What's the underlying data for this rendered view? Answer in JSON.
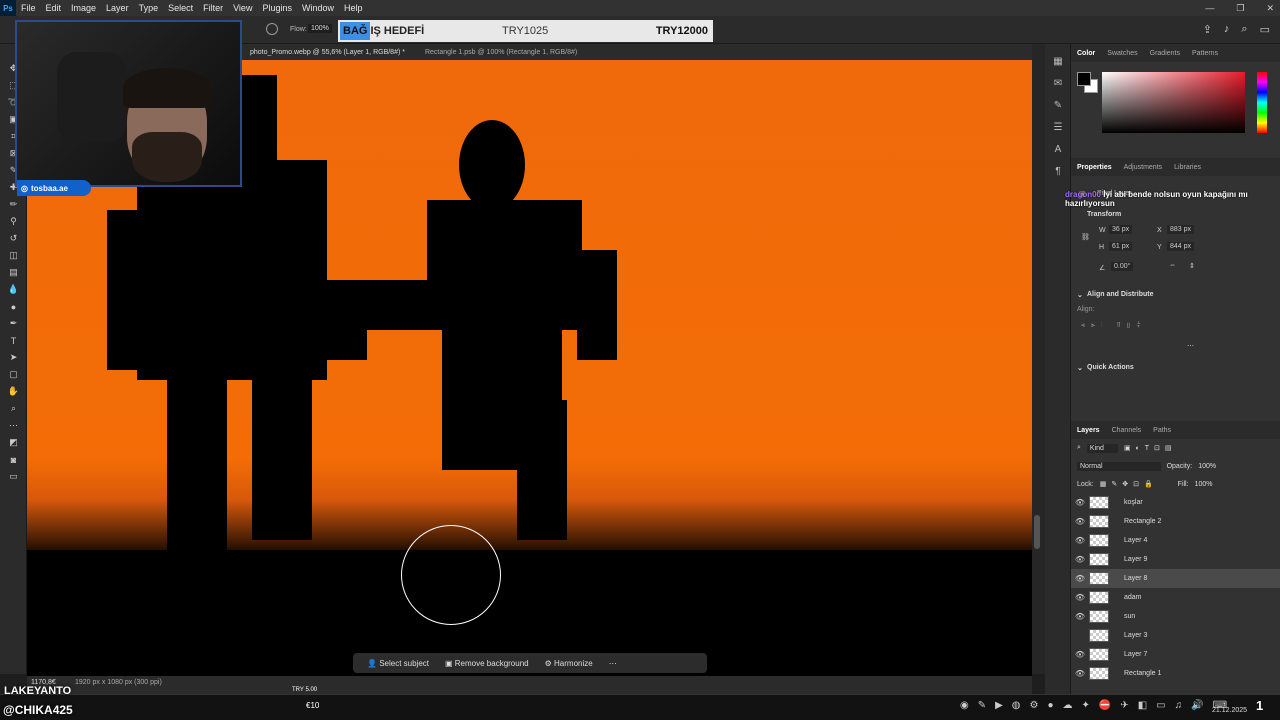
{
  "menu": [
    "File",
    "Edit",
    "Image",
    "Layer",
    "Type",
    "Select",
    "Filter",
    "View",
    "Plugins",
    "Window",
    "Help"
  ],
  "app_icon": "Ps",
  "options": {
    "flow_label": "Flow:",
    "flow_value": "100%"
  },
  "donation": {
    "highlight": "BAĞ",
    "rest": "IŞ HEDEFİ",
    "current": "TRY1025",
    "goal": "TRY12000"
  },
  "tabs": [
    "photo_Promo.webp @ 55,6% (Layer 1, RGB/8#) *",
    "Rectangle 1.psb @ 100% (Rectangle 1, RGB/8#)"
  ],
  "webcam_label": "tosbaa.ae",
  "color_panel": {
    "tabs": [
      "Color",
      "Swatches",
      "Gradients",
      "Patterns"
    ],
    "fg": "#000000",
    "bg": "#ffffff",
    "accent": "#e81c2a"
  },
  "properties": {
    "tabs": [
      "Properties",
      "Adjustments",
      "Libraries"
    ],
    "layer_type": "Pixel Layer",
    "transform": "Transform",
    "w": "36 px",
    "x": "883 px",
    "h": "61 px",
    "y": "844 px",
    "angle": "0.00°",
    "align": "Align and Distribute",
    "align_label": "Align:",
    "quick": "Quick Actions"
  },
  "chat": {
    "user": "dragon00",
    "message": "İyi abi bende nolsun oyun kapağını mı hazırlıyorsun"
  },
  "layers_panel": {
    "tabs": [
      "Layers",
      "Channels",
      "Paths"
    ],
    "kind": "Kind",
    "blend": "Normal",
    "opacity_label": "Opacity:",
    "opacity": "100%",
    "lock": "Lock:",
    "fill_label": "Fill:",
    "fill": "100%",
    "layers": [
      {
        "name": "koşlar",
        "visible": true
      },
      {
        "name": "Rectangle 2",
        "visible": true
      },
      {
        "name": "Layer 4",
        "visible": true
      },
      {
        "name": "Layer 9",
        "visible": true
      },
      {
        "name": "Layer 8",
        "visible": true,
        "selected": true
      },
      {
        "name": "adam",
        "visible": true
      },
      {
        "name": "sun",
        "visible": true
      },
      {
        "name": "Layer 3",
        "visible": false
      },
      {
        "name": "Layer 7",
        "visible": true
      },
      {
        "name": "Rectangle 1",
        "visible": true
      }
    ]
  },
  "context_bar": {
    "select_subject": "Select subject",
    "remove_background": "Remove background",
    "harmonize": "Harmonize"
  },
  "status": {
    "zoom": "1170,8€",
    "doc": "1920 px x 1080 px (300 ppi)"
  },
  "stream": {
    "name": "LAKEYANTO",
    "handle": "@CHIKA425",
    "try_small": "TRY 5.00",
    "coin": "€10"
  },
  "clock": {
    "time": "1",
    "date": "21.12.2025"
  }
}
